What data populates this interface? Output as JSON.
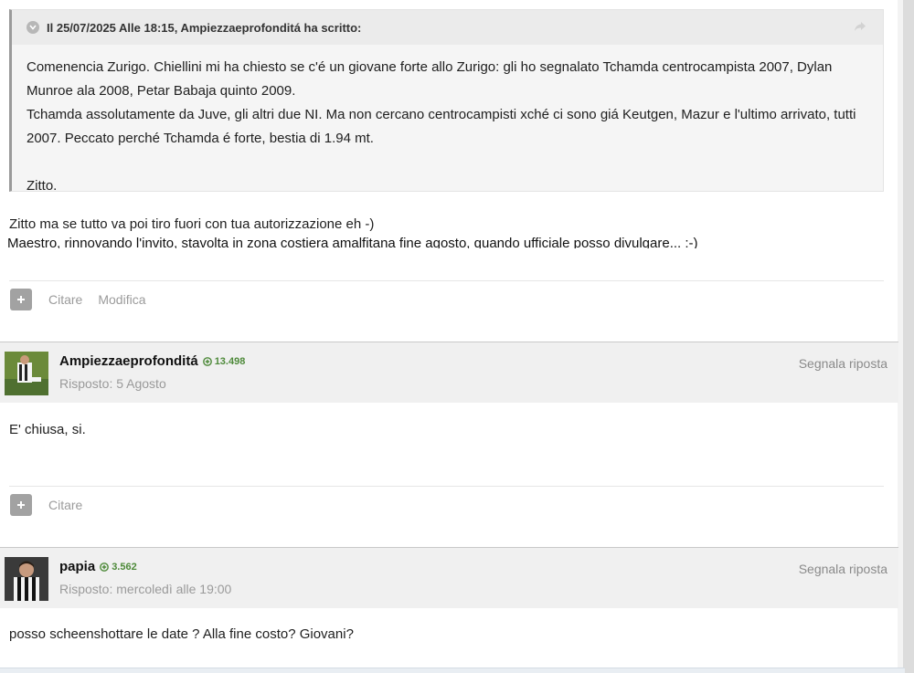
{
  "quote": {
    "title": "Il 25/07/2025 Alle 18:15, Ampiezzaeprofonditá ha scritto:",
    "lines": [
      "Comenencia Zurigo. Chiellini mi ha chiesto se c'é un giovane forte allo Zurigo: gli ho segnalato Tchamda centrocampista 2007, Dylan Munroe ala 2008, Petar Babaja quinto 2009.",
      "Tchamda assolutamente da Juve, gli altri due NI. Ma non cercano centrocampisti xché ci sono giá Keutgen, Mazur e l'ultimo arrivato, tutti 2007. Peccato perché Tchamda é forte, bestia di 1.94 mt.",
      "Zitto."
    ]
  },
  "post1": {
    "text": "Zitto ma se tutto va poi tiro fuori con tua autorizzazione eh -)",
    "garbled": "Maestro, rinnovando l'invito, stavolta in zona costiera amalfitana fine agosto, quando ufficiale posso divulgare... :-)",
    "actions": [
      "Citare",
      "Modifica"
    ]
  },
  "post2": {
    "author": "Ampiezzaeprofonditá",
    "reputation": "13.498",
    "date": "Risposto: 5 Agosto",
    "report": "Segnala riposta",
    "text": "E' chiusa, si.",
    "actions": [
      "Citare"
    ]
  },
  "post3": {
    "author": "papia",
    "reputation": "3.562",
    "date": "Risposto: mercoledì alle 19:00",
    "report": "Segnala riposta",
    "text": "posso scheenshottare le date ? Alla fine costo? Giovani?"
  },
  "icons": {
    "quote": "chevron-down-circle-icon",
    "share": "share-arrow-icon",
    "plus": "plus-icon",
    "reputation": "plus-circle-icon"
  },
  "colors": {
    "reputation": "#4e8a3a",
    "header_bg": "#f0f0f0",
    "quote_bg": "#f5f5f5"
  }
}
